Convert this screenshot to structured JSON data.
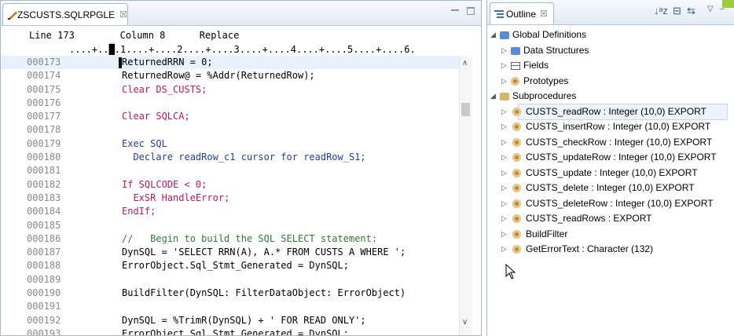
{
  "editor": {
    "tab_label": "ZSCUSTS.SQLRPGLE",
    "tab_close": "☒",
    "status_line": "Line 173        Column 8      Replace",
    "ruler": "....+..█.1....+....2....+....3....+....4....+....5....+....6.",
    "lines": [
      {
        "num": "000173",
        "text": "ReturnedRRN = 0;"
      },
      {
        "num": "000174",
        "text": "ReturnedRow@ = %Addr(ReturnedRow);"
      },
      {
        "num": "000175",
        "text": "Clear DS_CUSTS;"
      },
      {
        "num": "000176",
        "text": ""
      },
      {
        "num": "000177",
        "text": "Clear SQLCA;"
      },
      {
        "num": "000178",
        "text": ""
      },
      {
        "num": "000179",
        "text": "Exec SQL"
      },
      {
        "num": "000180",
        "text": "  Declare readRow_c1 cursor for readRow_S1;"
      },
      {
        "num": "000181",
        "text": ""
      },
      {
        "num": "000182",
        "text": "If SQLCODE < 0;"
      },
      {
        "num": "000183",
        "text": "  ExSR HandleError;"
      },
      {
        "num": "000184",
        "text": "EndIf;"
      },
      {
        "num": "000185",
        "text": ""
      },
      {
        "num": "000186",
        "text": "//   Begin to build the SQL SELECT statement:"
      },
      {
        "num": "000187",
        "text": "DynSQL = 'SELECT RRN(A), A.* FROM CUSTS A WHERE ';"
      },
      {
        "num": "000188",
        "text": "ErrorObject.Sql_Stmt_Generated = DynSQL;"
      },
      {
        "num": "000189",
        "text": ""
      },
      {
        "num": "000190",
        "text": "BuildFilter(DynSQL: FilterDataObject: ErrorObject)"
      },
      {
        "num": "000191",
        "text": ""
      },
      {
        "num": "000192",
        "text": "DynSQL = %TrimR(DynSQL) + ' FOR READ ONLY';"
      },
      {
        "num": "000193",
        "text": "ErrorObject.Sql_Stmt_Generated = DynSQL;"
      }
    ]
  },
  "outline": {
    "tab_label": "Outline",
    "tab_close": "☒",
    "tree": {
      "global": "Global Definitions",
      "data_structures": "Data Structures",
      "fields": "Fields",
      "prototypes": "Prototypes",
      "subprocedures": "Subprocedures",
      "procs": [
        "CUSTS_readRow : Integer (10,0) EXPORT",
        "CUSTS_insertRow : Integer (10,0) EXPORT",
        "CUSTS_checkRow : Integer (10,0) EXPORT",
        "CUSTS_updateRow : Integer (10,0) EXPORT",
        "CUSTS_update : Integer (10,0) EXPORT",
        "CUSTS_delete : Integer (10,0) EXPORT",
        "CUSTS_deleteRow : Integer (10,0) EXPORT",
        "CUSTS_readRows : EXPORT",
        "BuildFilter",
        "GetErrorText : Character (132)"
      ]
    }
  }
}
